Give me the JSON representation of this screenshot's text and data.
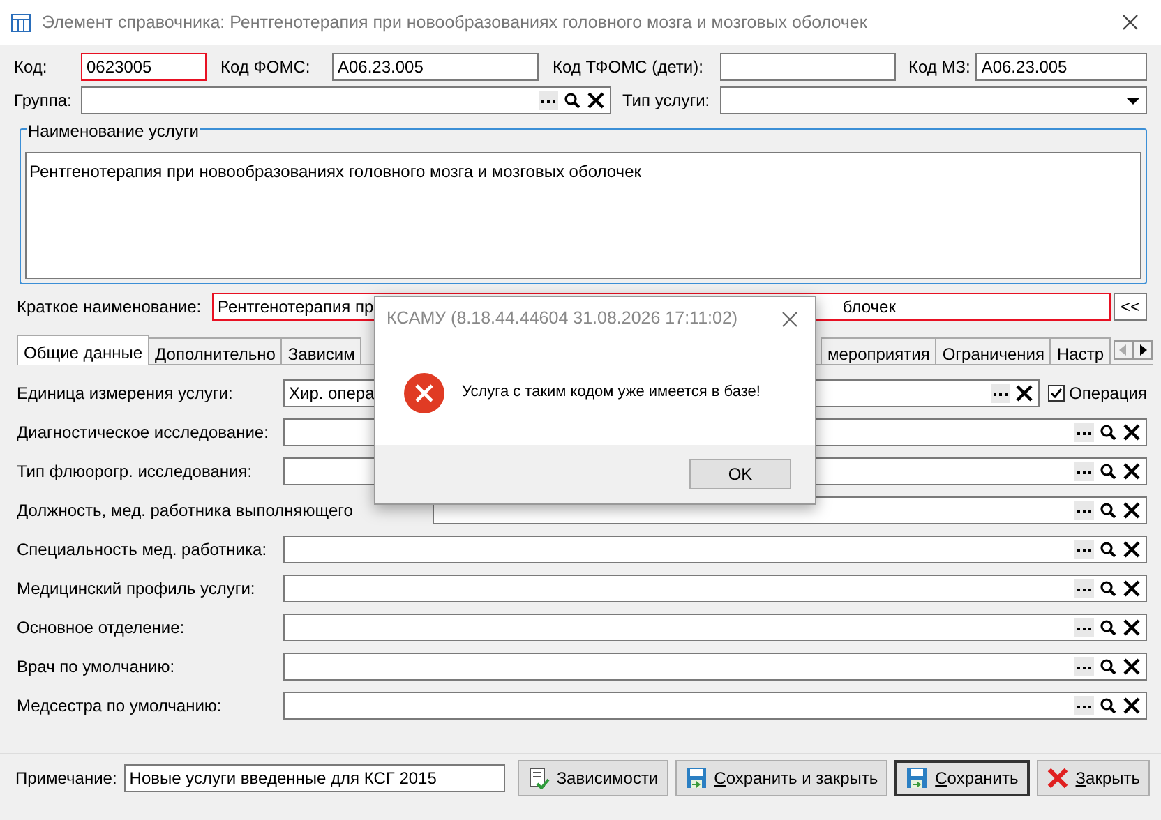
{
  "window": {
    "title": "Элемент справочника: Рентгенотерапия при новообразованиях головного мозга и мозговых оболочек"
  },
  "codes": [
    {
      "label": "Код:",
      "value": "0623005",
      "invalid": true
    },
    {
      "label": "Код ФОМС:",
      "value": "A06.23.005",
      "invalid": false
    },
    {
      "label": "Код ТФОМС (дети):",
      "invalid": false
    },
    {
      "label": "Код МЗ:",
      "value": "A06.23.005",
      "invalid": false
    }
  ],
  "group": {
    "label": "Группа:"
  },
  "service_type": {
    "label": "Тип услуги:"
  },
  "service_name": {
    "legend": "Наименование услуги",
    "value": "Рентгенотерапия при новообразованиях головного мозга и мозговых оболочек"
  },
  "short_name": {
    "label": "Краткое наименование:",
    "value_fragments": [
      "Рентгенотерапия пр",
      "блочек"
    ],
    "invalid": true,
    "button": "<<"
  },
  "tabs_before_dialog": [
    {
      "label": "Общие данные",
      "selected": true
    },
    {
      "label": "Дополнительно",
      "selected": false
    },
    {
      "label": "Зависим",
      "selected": false
    }
  ],
  "tabs_after_dialog": [
    {
      "label": "мероприятия",
      "selected": false
    },
    {
      "label": "Ограничения",
      "selected": false
    },
    {
      "label": "Настр",
      "selected": false
    }
  ],
  "rows": [
    {
      "kind": "unit",
      "label": "Единица измерения услуги:",
      "value": "Хир. опера",
      "checkbox": {
        "label": "Операция",
        "checked": true
      }
    },
    {
      "kind": "lookup",
      "label": "Диагностическое исследование:"
    },
    {
      "kind": "lookup",
      "label": "Тип флюорогр. исследования:"
    },
    {
      "kind": "lookup_wide",
      "label": "Должность, мед. работника выполняющего"
    },
    {
      "kind": "lookup",
      "label": "Специальность мед. работника:"
    },
    {
      "kind": "lookup",
      "label": "Медицинский профиль услуги:"
    },
    {
      "kind": "lookup",
      "label": "Основное отделение:"
    },
    {
      "kind": "lookup",
      "label": "Врач по умолчанию:"
    },
    {
      "kind": "lookup",
      "label": "Медсестра по умолчанию:"
    }
  ],
  "note": {
    "label": "Примечание:",
    "value": "Новые услуги введенные для КСГ 2015"
  },
  "buttons": [
    {
      "label": "Зависимости",
      "kind": "dependencies",
      "mnemonic": false,
      "default": false
    },
    {
      "label": "Сохранить и закрыть",
      "kind": "save",
      "mnemonic": true,
      "default": false
    },
    {
      "label": "Сохранить",
      "kind": "save",
      "mnemonic": true,
      "default": true
    },
    {
      "label": "Закрыть",
      "kind": "close",
      "mnemonic": true,
      "default": false
    }
  ],
  "dialog": {
    "title": "КСАМУ (8.18.44.44604 31.08.2026 17:11:02)",
    "kind": "error",
    "message": "Услуга с таким кодом уже имеется в базе!",
    "buttons": [
      "OK"
    ]
  }
}
